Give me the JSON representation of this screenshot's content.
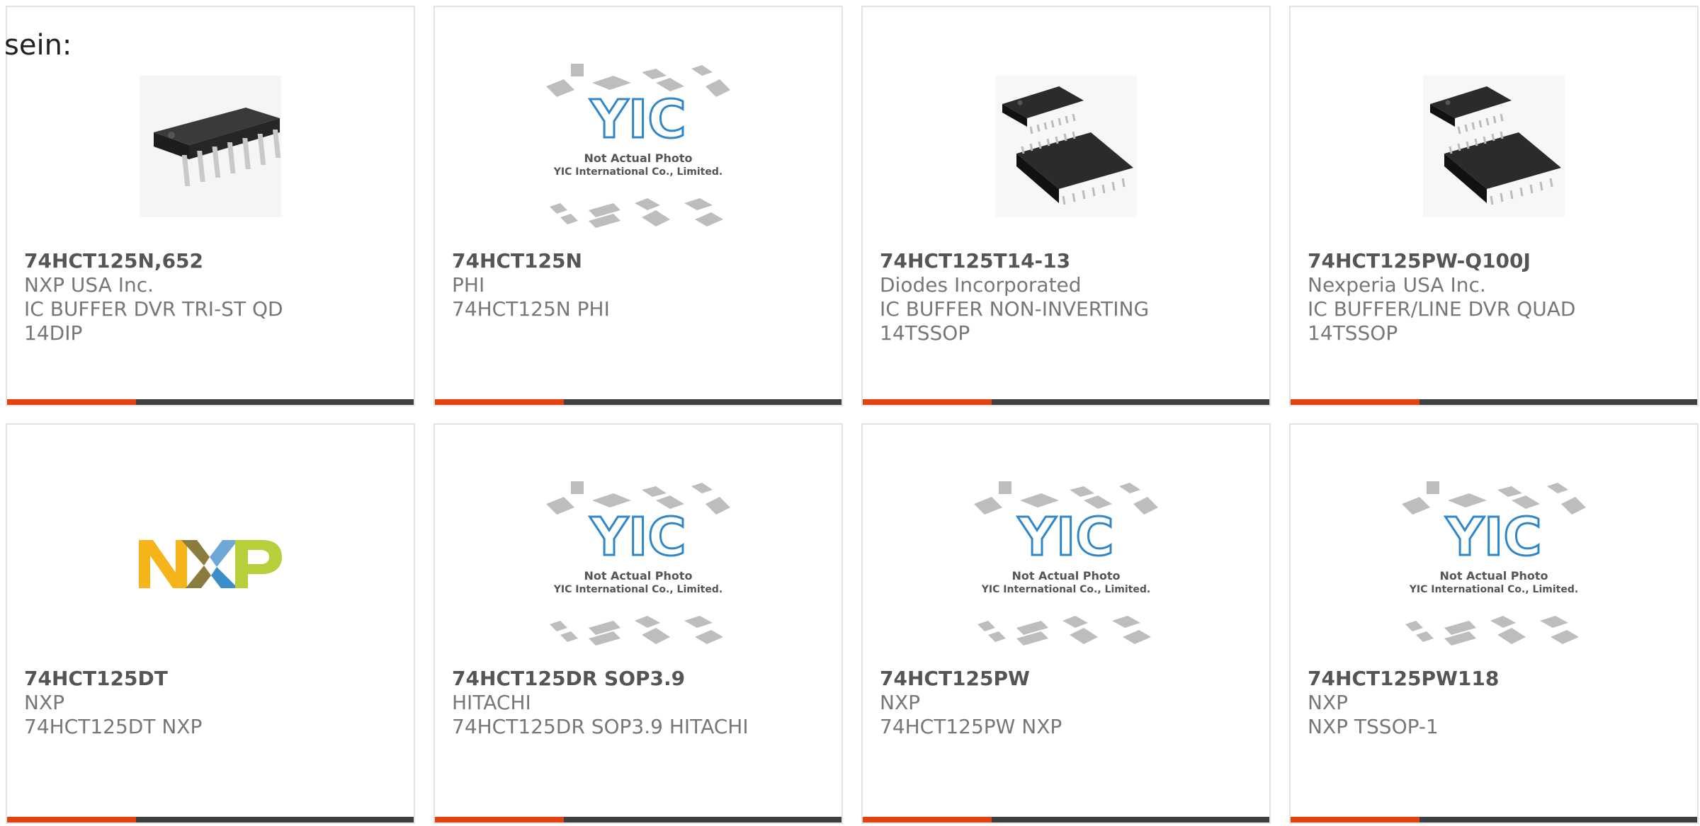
{
  "intro": "sein:",
  "colors": {
    "accent": "#e24210",
    "bar": "#3f3f3f",
    "title": "#555555",
    "text": "#777777"
  },
  "placeholder": {
    "line1": "Not Actual Photo",
    "line2": "YIC International Co., Limited.",
    "logo": "YIC"
  },
  "cards": [
    {
      "part": "74HCT125N,652",
      "maker": "NXP USA Inc.",
      "desc": [
        "IC BUFFER DVR TRI-ST QD",
        "14DIP"
      ],
      "image": "dip-chip"
    },
    {
      "part": "74HCT125N",
      "maker": "PHI",
      "desc": [
        "74HCT125N PHI"
      ],
      "image": "placeholder"
    },
    {
      "part": "74HCT125T14-13",
      "maker": "Diodes Incorporated",
      "desc": [
        "IC BUFFER NON-INVERTING",
        "14TSSOP"
      ],
      "image": "tssop-chip"
    },
    {
      "part": "74HCT125PW-Q100J",
      "maker": "Nexperia USA Inc.",
      "desc": [
        "IC BUFFER/LINE DVR QUAD",
        "14TSSOP"
      ],
      "image": "tssop-chip"
    },
    {
      "part": "74HCT125DT",
      "maker": "NXP",
      "desc": [
        "74HCT125DT NXP"
      ],
      "image": "nxp-logo"
    },
    {
      "part": "74HCT125DR SOP3.9",
      "maker": "HITACHI",
      "desc": [
        "74HCT125DR SOP3.9 HITACHI"
      ],
      "image": "placeholder"
    },
    {
      "part": "74HCT125PW",
      "maker": "NXP",
      "desc": [
        "74HCT125PW NXP"
      ],
      "image": "placeholder"
    },
    {
      "part": "74HCT125PW118",
      "maker": "NXP",
      "desc": [
        "NXP TSSOP-1"
      ],
      "image": "placeholder"
    }
  ]
}
